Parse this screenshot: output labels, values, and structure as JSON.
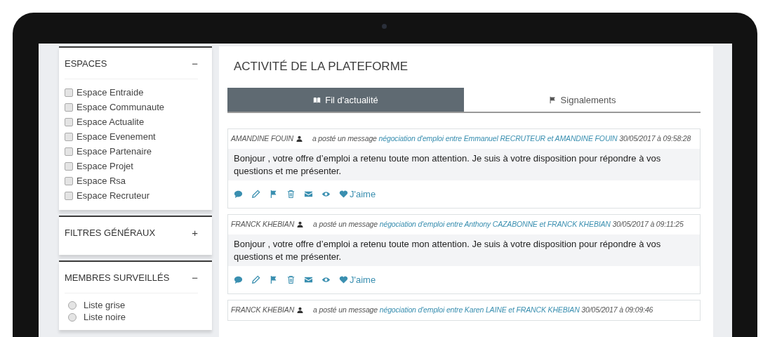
{
  "sidebar": {
    "sections": [
      {
        "title": "ESPACES",
        "toggle": "−",
        "kind": "checkbox",
        "items": [
          {
            "label": "Espace Entraide",
            "checked": false
          },
          {
            "label": "Espace Communaute",
            "checked": false
          },
          {
            "label": "Espace Actualite",
            "checked": false
          },
          {
            "label": "Espace Evenement",
            "checked": false
          },
          {
            "label": "Espace Partenaire",
            "checked": false
          },
          {
            "label": "Espace Projet",
            "checked": false
          },
          {
            "label": "Espace Rsa",
            "checked": false
          },
          {
            "label": "Espace Recruteur",
            "checked": false
          }
        ]
      },
      {
        "title": "FILTRES GÉNÉRAUX",
        "toggle": "+",
        "kind": "collapsed"
      },
      {
        "title": "MEMBRES SURVEILLÉS",
        "toggle": "−",
        "kind": "radio",
        "items": [
          {
            "label": "Liste grise",
            "selected": false
          },
          {
            "label": "Liste noire",
            "selected": false
          }
        ]
      }
    ]
  },
  "main": {
    "title": "ACTIVITÉ DE LA PLATEFORME",
    "tabs": [
      {
        "label": "Fil d'actualité",
        "selected": true
      },
      {
        "label": "Signalements",
        "selected": false
      }
    ],
    "posts": [
      {
        "author": "AMANDINE FOUIN",
        "action": "a posté un message",
        "link": "négociation d'emploi entre Emmanuel RECRUTEUR et AMANDINE FOUIN",
        "date": "30/05/2017 à 09:58:28",
        "body": "Bonjour , votre offre d’emploi a retenu toute mon attention. Je suis à votre disposition pour répondre à vos questions et me présenter.",
        "like": "J'aime"
      },
      {
        "author": "FRANCK KHEBIAN",
        "action": "a posté un message",
        "link": "négociation d'emploi entre Anthony CAZABONNE et FRANCK KHEBIAN",
        "date": "30/05/2017 à 09:11:25",
        "body": "Bonjour , votre offre d’emploi a retenu toute mon attention. Je suis à votre disposition pour répondre à vos questions et me présenter.",
        "like": "J'aime"
      },
      {
        "author": "FRANCK KHEBIAN",
        "action": "a posté un message",
        "link": "négociation d'emploi entre Karen LAINE et FRANCK KHEBIAN",
        "date": "30/05/2017 à 09:09:46"
      }
    ]
  }
}
